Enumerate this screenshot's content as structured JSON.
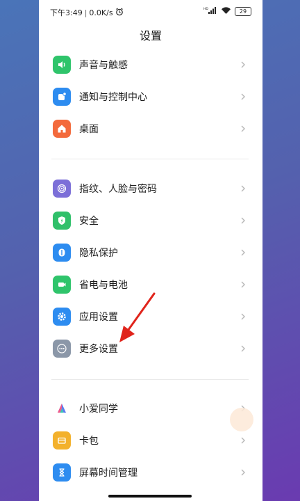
{
  "status": {
    "time": "下午3:49",
    "sep": "|",
    "speed": "0.0K/s",
    "battery": "29"
  },
  "title": "设置",
  "groups": [
    [
      {
        "label": "声音与触感",
        "icon": "speaker-icon",
        "color": "#2fc46b"
      },
      {
        "label": "通知与控制中心",
        "icon": "notification-icon",
        "color": "#2d8cf0"
      },
      {
        "label": "桌面",
        "icon": "home-icon",
        "color": "#f36a3c"
      }
    ],
    [
      {
        "label": "指纹、人脸与密码",
        "icon": "fingerprint-icon",
        "color": "#7c6fd8"
      },
      {
        "label": "安全",
        "icon": "shield-icon",
        "color": "#30c06a"
      },
      {
        "label": "隐私保护",
        "icon": "privacy-icon",
        "color": "#2d8cf0"
      },
      {
        "label": "省电与电池",
        "icon": "battery-icon",
        "color": "#2fc46b"
      },
      {
        "label": "应用设置",
        "icon": "app-settings-icon",
        "color": "#2d8cf0"
      },
      {
        "label": "更多设置",
        "icon": "more-icon",
        "color": "#8b97a8"
      }
    ],
    [
      {
        "label": "小爱同学",
        "icon": "xiaoai-icon",
        "color": "#ffffff"
      },
      {
        "label": "卡包",
        "icon": "wallet-icon",
        "color": "#f3b12c"
      },
      {
        "label": "屏幕时间管理",
        "icon": "hourglass-icon",
        "color": "#2d8cf0"
      }
    ]
  ],
  "annotation_arrow_color": "#e0241b"
}
